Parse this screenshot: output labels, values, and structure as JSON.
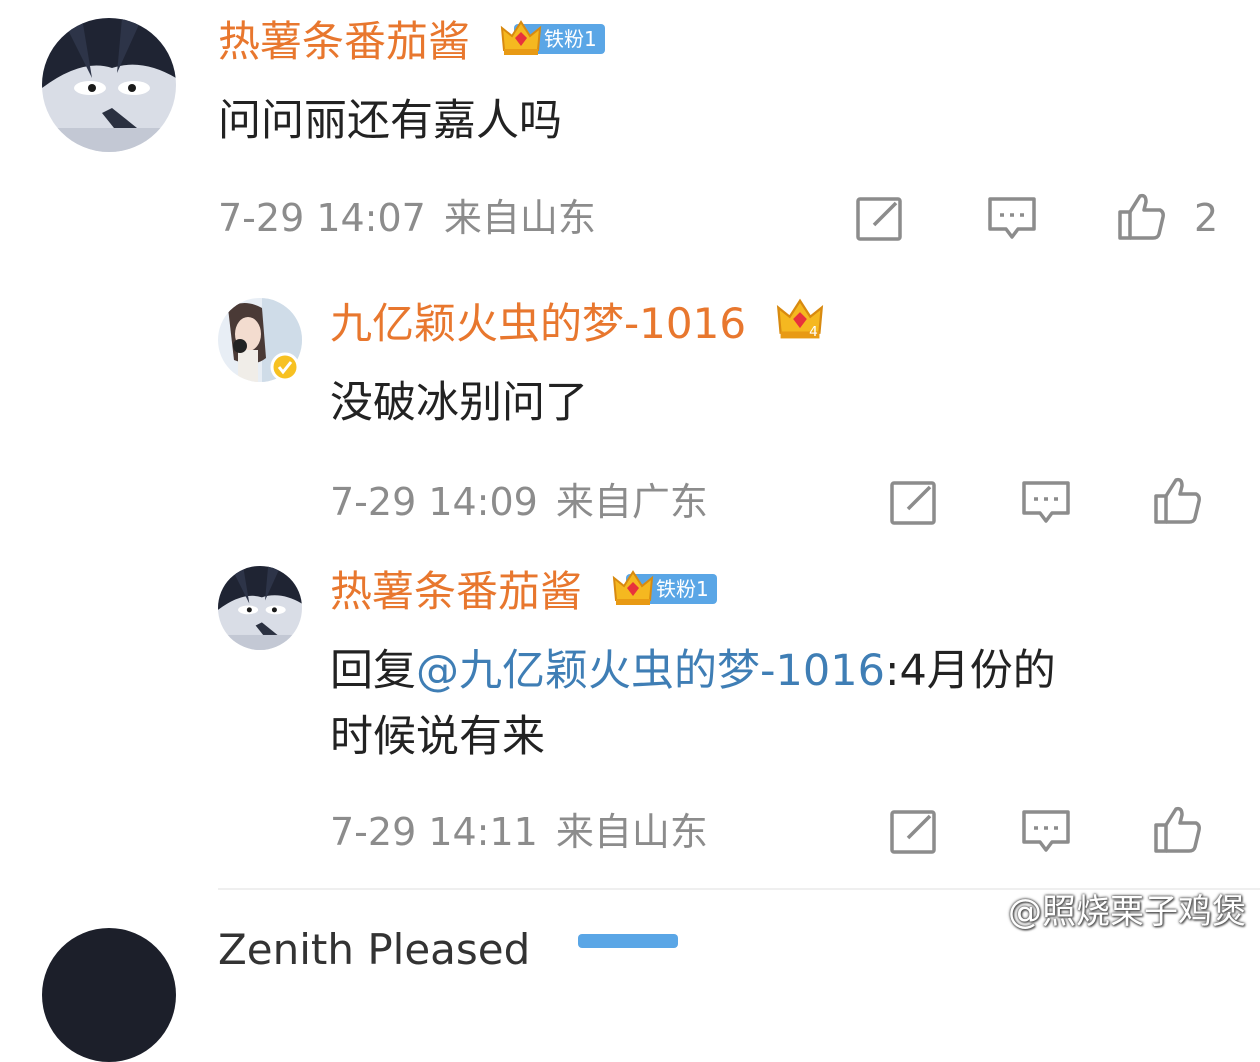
{
  "comments": [
    {
      "username": "热薯条番茄酱",
      "fan_badge": "铁粉1",
      "content": "问问丽还有嘉人吗",
      "time": "7-29 14:07",
      "location": "来自山东",
      "like_count": "2"
    },
    {
      "username": "九亿颖火虫的梦-1016",
      "crown_level": "4",
      "content": "没破冰别问了",
      "time": "7-29 14:09",
      "location": "来自广东"
    },
    {
      "username": "热薯条番茄酱",
      "fan_badge": "铁粉1",
      "content_prefix": "回复",
      "mention": "@九亿颖火虫的梦-1016",
      "content_suffix": ":4月份的",
      "content_line2": "时候说有来",
      "time": "7-29 14:11",
      "location": "来自山东"
    }
  ],
  "next_comment": {
    "username_partial": "Zenith Pleased"
  },
  "watermark": "@照烧栗子鸡煲",
  "colors": {
    "username": "#e8772e",
    "mention": "#3f7eb5",
    "meta": "#8c8c8c",
    "fan_badge": "#5aa6e6"
  },
  "icons": [
    "share-icon",
    "comment-icon",
    "like-icon",
    "crown-icon",
    "weibo-logo-icon"
  ]
}
